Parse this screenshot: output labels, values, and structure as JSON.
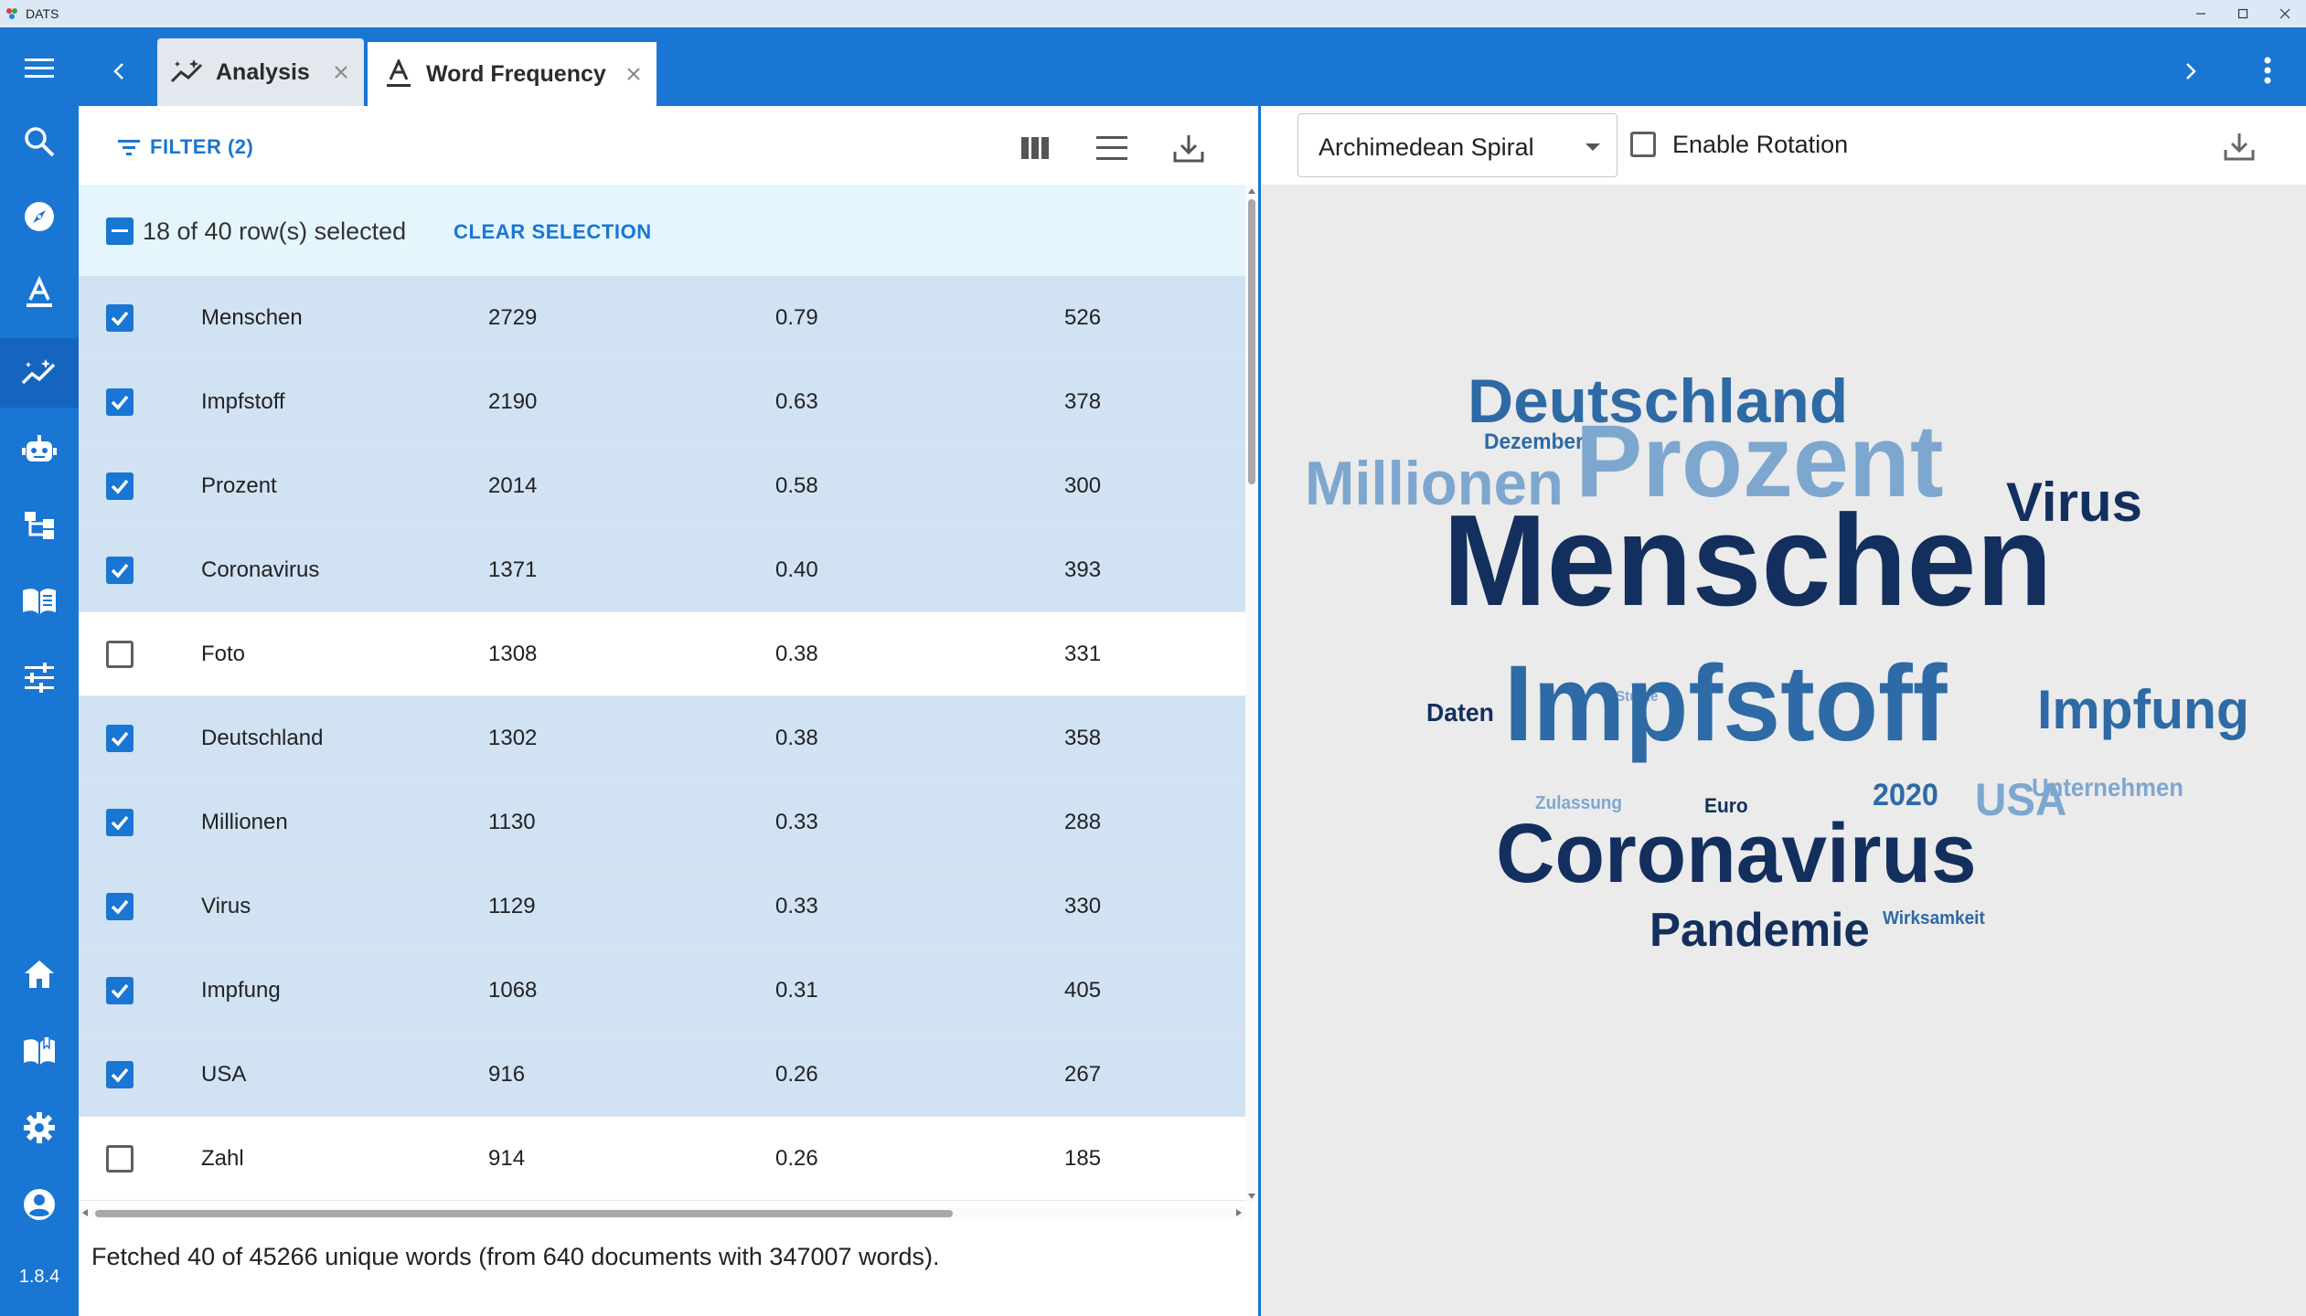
{
  "os_title": {
    "app_name": "DATS"
  },
  "tabs": [
    {
      "label": "Analysis",
      "icon": "analysis-icon"
    },
    {
      "label": "Word Frequency",
      "icon": "text-format-icon"
    }
  ],
  "sidebar": {
    "items": [
      "search-icon",
      "explore-icon",
      "text-format-icon",
      "analysis-icon",
      "robot-icon",
      "hierarchy-icon",
      "open-book-icon",
      "tune-icon"
    ],
    "bottom_items": [
      "home-icon",
      "docs-book-icon",
      "settings-icon",
      "account-icon"
    ],
    "version": "1.8.4"
  },
  "toolbar": {
    "filter_label": "FILTER (2)"
  },
  "selection": {
    "text": "18 of 40 row(s) selected",
    "clear_label": "CLEAR SELECTION"
  },
  "table": {
    "rows": [
      {
        "word": "Menschen",
        "count": "2729",
        "percent": "0.79",
        "docs": "526",
        "selected": true
      },
      {
        "word": "Impfstoff",
        "count": "2190",
        "percent": "0.63",
        "docs": "378",
        "selected": true
      },
      {
        "word": "Prozent",
        "count": "2014",
        "percent": "0.58",
        "docs": "300",
        "selected": true
      },
      {
        "word": "Coronavirus",
        "count": "1371",
        "percent": "0.40",
        "docs": "393",
        "selected": true
      },
      {
        "word": "Foto",
        "count": "1308",
        "percent": "0.38",
        "docs": "331",
        "selected": false
      },
      {
        "word": "Deutschland",
        "count": "1302",
        "percent": "0.38",
        "docs": "358",
        "selected": true
      },
      {
        "word": "Millionen",
        "count": "1130",
        "percent": "0.33",
        "docs": "288",
        "selected": true
      },
      {
        "word": "Virus",
        "count": "1129",
        "percent": "0.33",
        "docs": "330",
        "selected": true
      },
      {
        "word": "Impfung",
        "count": "1068",
        "percent": "0.31",
        "docs": "405",
        "selected": true
      },
      {
        "word": "USA",
        "count": "916",
        "percent": "0.26",
        "docs": "267",
        "selected": true
      },
      {
        "word": "Zahl",
        "count": "914",
        "percent": "0.26",
        "docs": "185",
        "selected": false
      }
    ]
  },
  "footer": {
    "text": "Fetched 40 of 45266 unique words (from 640 documents with 347007 words)."
  },
  "wordcloud": {
    "layout_select": "Archimedean Spiral",
    "rotation_label": "Enable Rotation",
    "rotation_enabled": false,
    "palette": {
      "dark": "#132f5e",
      "mid": "#2e6aa5",
      "light": "#7ea7cf"
    },
    "words": [
      {
        "text": "Deutschland",
        "color": "#2e6aa5"
      },
      {
        "text": "Dezember",
        "color": "#2e6aa5"
      },
      {
        "text": "Millionen",
        "color": "#7ea7cf"
      },
      {
        "text": "Prozent",
        "color": "#7ea7cf"
      },
      {
        "text": "Virus",
        "color": "#132f5e"
      },
      {
        "text": "Menschen",
        "color": "#132f5e"
      },
      {
        "text": "Studie",
        "color": "#7ea7cf"
      },
      {
        "text": "Daten",
        "color": "#132f5e"
      },
      {
        "text": "Impfstoff",
        "color": "#2e6aa5"
      },
      {
        "text": "Impfung",
        "color": "#2e6aa5"
      },
      {
        "text": "Unternehmen",
        "color": "#7ea7cf"
      },
      {
        "text": "Zulassung",
        "color": "#7ea7cf"
      },
      {
        "text": "Euro",
        "color": "#132f5e"
      },
      {
        "text": "2020",
        "color": "#2e6aa5"
      },
      {
        "text": "USA",
        "color": "#7ea7cf"
      },
      {
        "text": "Coronavirus",
        "color": "#132f5e"
      },
      {
        "text": "Wirksamkeit",
        "color": "#2e6aa5"
      },
      {
        "text": "Pandemie",
        "color": "#132f5e"
      }
    ]
  }
}
